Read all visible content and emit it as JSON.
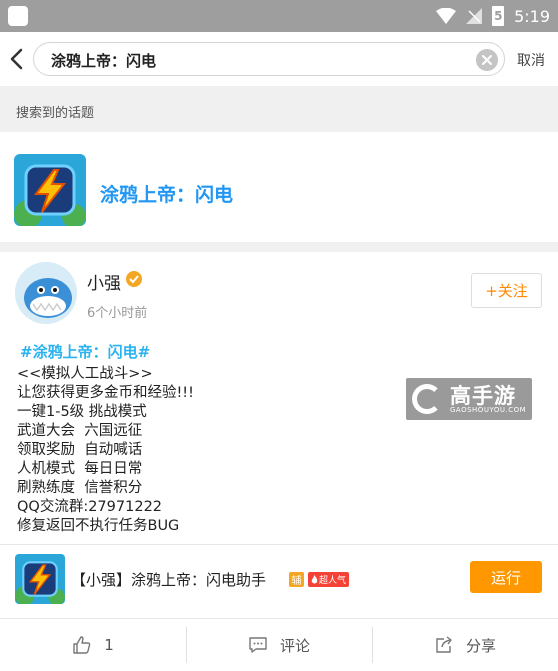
{
  "status_bar": {
    "time": "5:19",
    "battery": "5"
  },
  "search": {
    "query": "涂鸦上帝：闪电",
    "cancel_label": "取消"
  },
  "results_section": {
    "heading": "搜索到的话题"
  },
  "topic": {
    "title": "涂鸦上帝：闪电"
  },
  "post": {
    "username": "小强",
    "time_ago": "6个小时前",
    "follow_label": "+关注",
    "hashtag": "#涂鸦上帝：闪电#",
    "body_lines": [
      "<<模拟人工战斗>>",
      "让您获得更多金币和经验!!!",
      "一键1-5级 挑战模式",
      "武道大会  六国远征",
      "领取奖励  自动喊话",
      "人机模式  每日日常",
      "刷熟练度  信誉积分",
      "QQ交流群:27971222",
      "修复返回不执行任务BUG"
    ],
    "watermark": {
      "title": "高手游",
      "subtitle": "GAOSHOUYOU.COM"
    },
    "app": {
      "name": "【小强】涂鸦上帝：闪电助手",
      "badge_assist": "辅",
      "badge_hot": "超人气",
      "run_label": "运行"
    },
    "actions": {
      "like_count": "1",
      "comment_label": "评论",
      "share_label": "分享"
    }
  },
  "colors": {
    "accent_blue": "#2196f3",
    "hashtag_blue": "#2bb3f0",
    "orange": "#ff9800",
    "status_bar": "#9e9e9e"
  }
}
